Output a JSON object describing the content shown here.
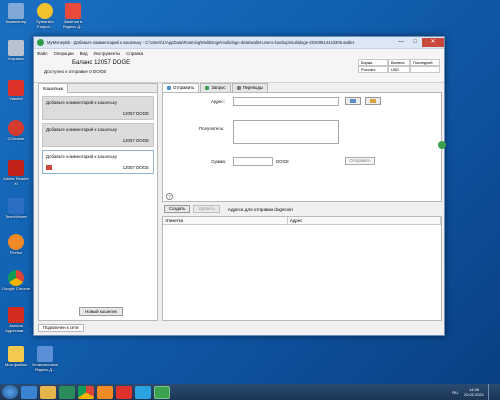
{
  "desktop": {
    "icons": [
      {
        "label": "Компьютер"
      },
      {
        "label": "Symantec Endpoi..."
      },
      {
        "label": "Заметки в Яндекс.Д..."
      },
      {
        "label": "Корзина"
      },
      {
        "label": "Yandex"
      },
      {
        "label": "CCleaner"
      },
      {
        "label": "Adobe Reader XI"
      },
      {
        "label": "TeamViewer"
      },
      {
        "label": "Firefox"
      },
      {
        "label": "Google Chrome"
      },
      {
        "label": "Акелла Адресная..."
      },
      {
        "label": "Мои файлы"
      },
      {
        "label": "Установочные Яндекс.Д..."
      }
    ]
  },
  "window": {
    "title": "MyMoneyBit - Добавьте комментарий к кошельку - C:\\Users\\1\\AppData\\Roaming\\MultiDoge\\multidoge-data\\wallet-unenc-backup\\multidoge-20200814143306.wallet",
    "minimize": "—",
    "maximize": "□",
    "close": "✕"
  },
  "menu": [
    "Файл",
    "Операции",
    "Вид",
    "Инструменты",
    "Справка"
  ],
  "header": {
    "balance": "Баланс  12057 DOGE",
    "available": "Доступно к отправке  0 DOGE",
    "rates_headers": [
      "Биржа",
      "Валюта",
      "Последний"
    ],
    "rates_values": [
      "Poloniex",
      "USD",
      ""
    ]
  },
  "wallets_panel": {
    "tab_label": "Кошельки",
    "wallets": [
      {
        "comment": "Добавьте комментарий к кошельку",
        "amount": "12057 DOGE"
      },
      {
        "comment": "Добавьте комментарий к кошельку",
        "amount": "12057 DOGE"
      },
      {
        "comment": "Добавьте комментарий к кошельку",
        "amount": "12057 DOGE"
      }
    ],
    "new_wallet_label": "Новый кошелек"
  },
  "right_tabs": [
    {
      "label": "Отправить"
    },
    {
      "label": "Запрос"
    },
    {
      "label": "Переводы"
    }
  ],
  "send_form": {
    "address_label": "Адрес:",
    "recipient_label": "Получатель:",
    "amount_label": "Сумма:",
    "currency": "DOGE",
    "send_label": "Отправить",
    "help": "?"
  },
  "address_book": {
    "create_label": "Создать",
    "delete_label": "Удалить",
    "caption": "Адреса для отправки dogecoin",
    "columns": [
      "Этикетка",
      "Адрес"
    ]
  },
  "status_tab": "Подключен к сети",
  "taskbar": {
    "lang": "RU",
    "time": "14:46",
    "date": "20.02.2021"
  },
  "colors": {
    "desktop": "#1262b3",
    "accent": "#3aa14e",
    "close": "#c9483c"
  }
}
